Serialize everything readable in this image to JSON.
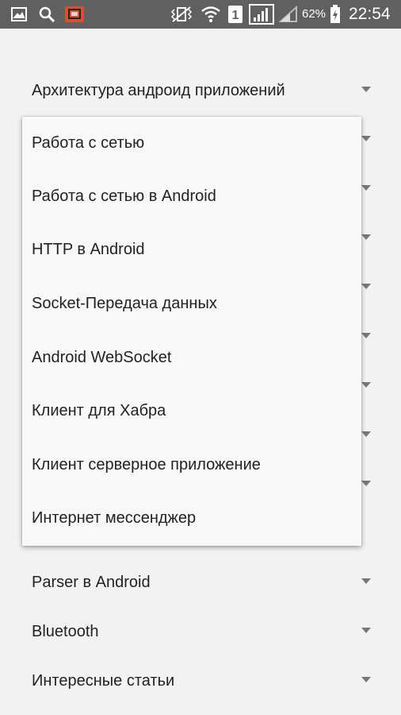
{
  "status_bar": {
    "icons": [
      "gallery-icon",
      "search-icon",
      "app-notification-icon",
      "vibrate-icon",
      "wifi-icon",
      "sim-1-icon",
      "signal-icon",
      "signal-icon",
      "battery-charging-icon"
    ],
    "battery_percent": "62%",
    "time": "22:54",
    "sim_label": "1",
    "colors": {
      "bar": "#606060",
      "app_icon": "#d9502f"
    }
  },
  "menu": {
    "items": [
      {
        "label": "Архитектура андроид приложений",
        "icon": "dropdown-arrow-icon"
      },
      {
        "label": "",
        "icon": "dropdown-arrow-icon"
      },
      {
        "label": "",
        "icon": "dropdown-arrow-icon"
      },
      {
        "label": "",
        "icon": "dropdown-arrow-icon"
      },
      {
        "label": "",
        "icon": "dropdown-arrow-icon"
      },
      {
        "label": "",
        "icon": "dropdown-arrow-icon"
      },
      {
        "label": "",
        "icon": "dropdown-arrow-icon"
      },
      {
        "label": "",
        "icon": "dropdown-arrow-icon"
      },
      {
        "label": "",
        "icon": "dropdown-arrow-icon"
      },
      {
        "label": "Parser в Android",
        "icon": "dropdown-arrow-icon"
      },
      {
        "label": "Bluetooth",
        "icon": "dropdown-arrow-icon"
      },
      {
        "label": "Интересные статьи",
        "icon": "dropdown-arrow-icon"
      }
    ]
  },
  "popup": {
    "items": [
      "Работа с сетью",
      "Работа с сетью в Android",
      "HTTP в Android",
      "Socket-Передача данных",
      "Android WebSocket",
      "Клиент для Хабра",
      "Клиент серверное приложение",
      "Интернет мессенджер"
    ]
  },
  "colors": {
    "background": "#f2f2f2",
    "popup": "#f8f8f8",
    "text": "#222222",
    "arrow": "#777777"
  }
}
